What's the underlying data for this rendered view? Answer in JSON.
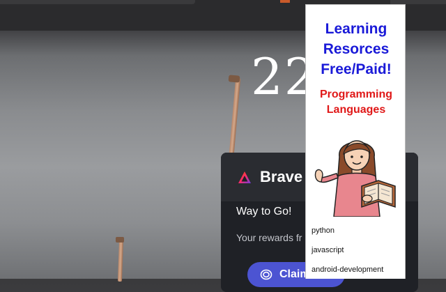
{
  "clock": {
    "time": "22"
  },
  "brave_card": {
    "title": "Brave",
    "heading": "Way to Go!",
    "body": "Your rewards fr",
    "claim_label": "Claim"
  },
  "popup": {
    "title_line1": "Learning",
    "title_line2": "Resorces",
    "title_line3": "Free/Paid!",
    "subtitle_line1": "Programming",
    "subtitle_line2": "Languages",
    "languages": [
      "python",
      "javascript",
      "android-development"
    ]
  },
  "colors": {
    "popup_title": "#1a1ad8",
    "popup_subtitle": "#e01818",
    "claim_button": "#4c54d2",
    "brave_card_bg": "#1f2126"
  },
  "icons": {
    "brave": "brave-logo-icon",
    "claim": "rewards-icon",
    "teacher": "teacher-illustration"
  }
}
